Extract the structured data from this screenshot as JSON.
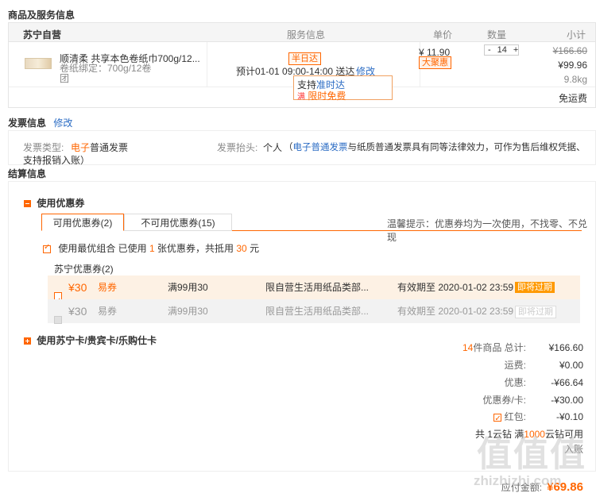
{
  "goods": {
    "section_title": "商品及服务信息",
    "store": "苏宁自营",
    "col_service": "服务信息",
    "col_price": "单价",
    "col_qty": "数量",
    "col_subtotal": "小计",
    "item": {
      "name": "顺清柔 共享本色卷纸巾700g/12...",
      "spec": "卷纸绑定：700g/12卷",
      "spec2": "团",
      "delivery_tag": "半日达",
      "delivery_time": "预计01-01 09:00-14:00 送达",
      "modify": "修改",
      "service1_prefix": "支持",
      "service1_hl": "准时达",
      "service2_icon": "满",
      "service2": "限时免费",
      "price": "¥ 11.90",
      "price_tag": "大聚惠",
      "qty_minus": "-",
      "qty": "14",
      "qty_plus": "+",
      "orig_subtotal": "¥166.60",
      "subtotal": "¥99.96",
      "weight": "9.8kg",
      "shipping": "免运费"
    }
  },
  "invoice": {
    "section_title": "发票信息",
    "modify": "修改",
    "type_label": "发票类型:",
    "type_hl": "电子",
    "type_rest": "普通发票",
    "head_label": "发票抬头:",
    "head_value": "个人",
    "note_open": "（",
    "note_hl": "电子普通发票",
    "note_rest": "与纸质普通发票具有同等法律效力，可作为售后维权凭据、",
    "note_line2": "支持报销入账）"
  },
  "settle": {
    "section_title": "结算信息",
    "coupon_title": "使用优惠券",
    "tab_available": "可用优惠券(2)",
    "tab_unavailable": "不可用优惠券(15)",
    "tip": "温馨提示：优惠券均为一次使用，不找零、不兑现",
    "combo_text1": "使用最优组合  已使用 ",
    "combo_count": "1",
    "combo_text2": " 张优惠券，共抵用 ",
    "combo_amount": "30",
    "combo_text3": " 元",
    "coupon_group": "苏宁优惠券(2)",
    "coupons": [
      {
        "amount": "¥30",
        "type": "易券",
        "rule": "满99用30",
        "scope": "限自营生活用纸品类部...",
        "expire": "有效期至 2020-01-02 23:59",
        "tag": "即将过期"
      },
      {
        "amount": "¥30",
        "type": "易券",
        "rule": "满99用30",
        "scope": "限自营生活用纸品类部...",
        "expire": "有效期至 2020-01-02 23:59",
        "tag": "即将过期"
      }
    ],
    "card_title": "使用苏宁卡/贵宾卡/乐购仕卡"
  },
  "summary": {
    "count": "14",
    "count_suffix": "件商品  总计:",
    "total": "¥166.60",
    "freight_label": "运费:",
    "freight": "¥0.00",
    "discount_label": "优惠:",
    "discount": "-¥66.64",
    "coupon_label": "优惠券/卡:",
    "coupon": "-¥30.00",
    "redpacket_label": "红包:",
    "redpacket": "-¥0.10",
    "cloud_prefix": "共 1云钻 满",
    "cloud_hl": "1000",
    "cloud_suffix": "云钻可用",
    "invoice_person": "入账",
    "pay_label": "应付金额:",
    "pay": "¥69.86"
  },
  "watermark": {
    "glyphs": "值值值",
    "site": "zhizhizhi.com"
  },
  "colors": {
    "accent": "#ff6600",
    "link": "#2b6cc4",
    "highlight_row": "#fdf1e4"
  }
}
